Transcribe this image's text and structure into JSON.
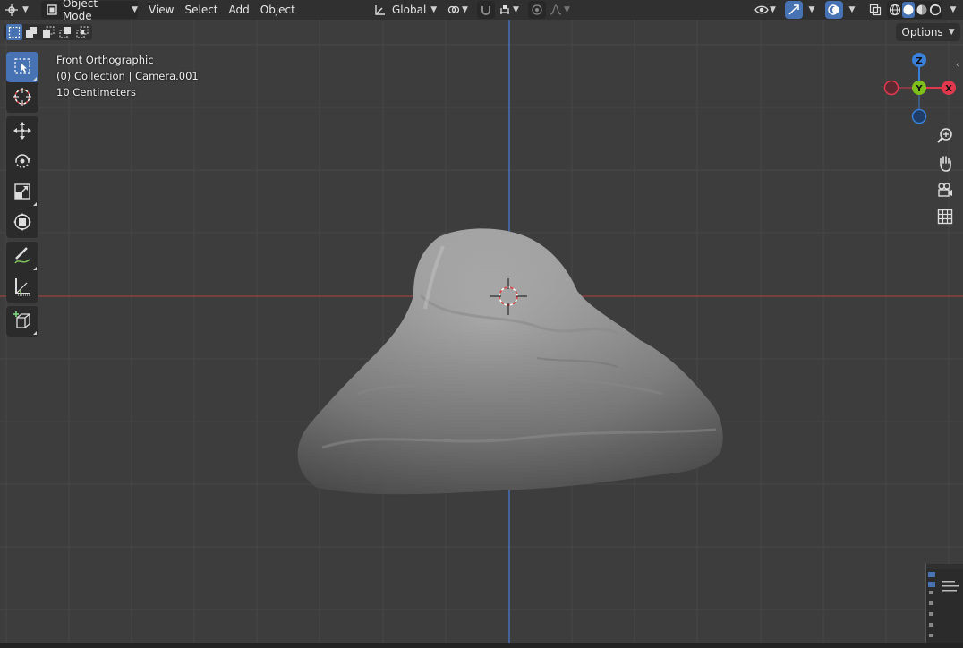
{
  "header": {
    "mode_label": "Object Mode",
    "menus": [
      "View",
      "Select",
      "Add",
      "Object"
    ],
    "transform_orientation": "Global"
  },
  "options_label": "Options",
  "overlay": {
    "view_name": "Front Orthographic",
    "collection": "(0) Collection | Camera.001",
    "scale": "10 Centimeters"
  },
  "gizmo": {
    "z_label": "Z",
    "y_label": "Y",
    "x_label": "X",
    "x_color": "#e0384d",
    "y_color": "#7fbf1a",
    "z_color": "#3a7fd9"
  },
  "colors": {
    "accent": "#4772b3",
    "x_axis_line": "#b0423f",
    "z_axis_line": "#4c7bd6"
  },
  "toolbar": [
    "select-box-icon",
    "cursor-icon",
    "move-icon",
    "rotate-icon",
    "scale-icon",
    "transform-icon",
    "annotate-icon",
    "measure-icon",
    "add-cube-icon"
  ]
}
